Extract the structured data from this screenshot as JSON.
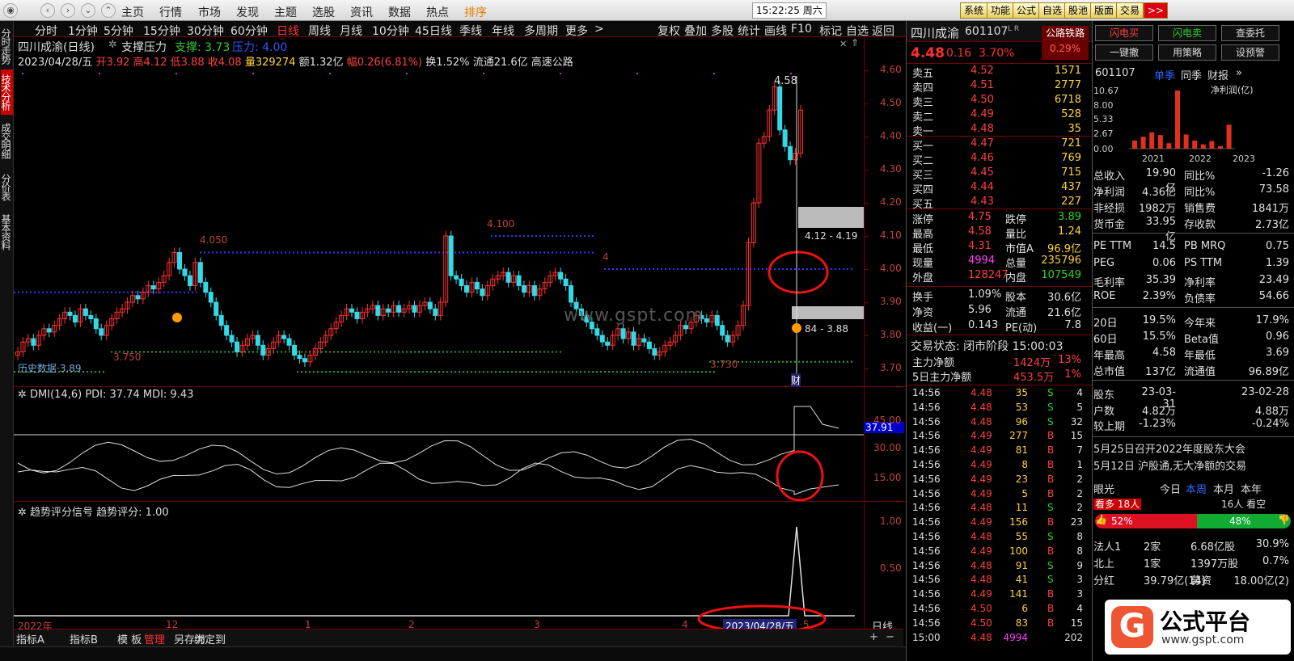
{
  "topmenu": {
    "items": [
      "主页",
      "行情",
      "市场",
      "发现",
      "主题",
      "选股",
      "资讯",
      "数据",
      "热点",
      "排序"
    ],
    "clock": "15:22:25 周六",
    "right_buttons": [
      "系统",
      "功能",
      "公式",
      "自选",
      "股池",
      "版面",
      "交易",
      ">>"
    ]
  },
  "left_tabs": [
    "分时走势",
    "技术分析",
    "成交明细",
    "分价表",
    "基本资料"
  ],
  "periods": {
    "items": [
      "分时",
      "1分钟",
      "5分钟",
      "15分钟",
      "30分钟",
      "60分钟",
      "日线",
      "周线",
      "月线",
      "10分钟",
      "45日线",
      "季线",
      "年线",
      "多周期",
      "更多"
    ],
    "active": "日线",
    "more_arrow": ">"
  },
  "tools": [
    "复权",
    "叠加",
    "多股",
    "统计",
    "画线",
    "F10",
    "标记",
    "自选",
    "返回"
  ],
  "chart": {
    "title": "四川成渝(日线)",
    "indicator": "支撑压力",
    "support_label": "支撑: 3.73",
    "pressure_label": "压力: 4.00",
    "info": {
      "date": "2023/04/28/五",
      "open": "开3.92",
      "high": "高4.12",
      "low": "低3.88",
      "close": "收4.08",
      "vol": "量329274",
      "amt": "额1.32亿",
      "chg": "幅0.26(6.81%)",
      "turn": "换1.52%",
      "float": "流通21.6亿",
      "sector": "高速公路"
    },
    "annotations": {
      "peak1": "4.050",
      "peak2": "4.100",
      "peak3": "4",
      "peak4": "4.58",
      "low1": "3.750",
      "low2": "3.730",
      "low3": "3.89",
      "range1": "4.12 - 4.19",
      "range2": "84 - 3.88",
      "cai": "财",
      "watermark": "www.gspt.com",
      "faded_text": "历史数据"
    },
    "yticks": [
      "4.60",
      "4.50",
      "4.40",
      "4.30",
      "4.20",
      "4.10",
      "4.00",
      "3.90",
      "3.80",
      "3.70"
    ],
    "dmi": {
      "label": "DMI(14,6) PDI: 37.74 MDI: 9.43",
      "yticks": [
        "45.00",
        "30.00",
        "15.00"
      ],
      "current": "37.91"
    },
    "trend": {
      "label": "趋势评分信号 趋势评分: 1.00",
      "yticks": [
        "1.00",
        "0.50"
      ]
    },
    "xaxis": [
      "2022年",
      "12",
      "1",
      "2",
      "3",
      "4",
      "5"
    ],
    "cursor_date": "2023/04/28/五",
    "period_label": "日线"
  },
  "bottom_tabs": [
    "指标A",
    "指标B",
    "模 板",
    "管理",
    "另存为",
    "绑定到"
  ],
  "quote": {
    "name": "四川成渝",
    "code": "601107",
    "flags": "L R",
    "price": "4.48",
    "chg": "0.16",
    "pct": "3.70%",
    "sector": "公路铁路",
    "sector_pct": "0.29%",
    "sells": [
      [
        "卖五",
        "4.52",
        "1571"
      ],
      [
        "卖四",
        "4.51",
        "2777"
      ],
      [
        "卖三",
        "4.50",
        "6718"
      ],
      [
        "卖二",
        "4.49",
        "528"
      ],
      [
        "卖一",
        "4.48",
        "35"
      ]
    ],
    "buys": [
      [
        "买一",
        "4.47",
        "721"
      ],
      [
        "买二",
        "4.46",
        "769"
      ],
      [
        "买三",
        "4.45",
        "715"
      ],
      [
        "买四",
        "4.44",
        "437"
      ],
      [
        "买五",
        "4.43",
        "227"
      ]
    ],
    "stats": [
      [
        "涨停",
        "4.75",
        "跌停",
        "3.89"
      ],
      [
        "最高",
        "4.58",
        "量比",
        "1.24"
      ],
      [
        "最低",
        "4.31",
        "市值A",
        "96.9亿"
      ],
      [
        "现量",
        "4994",
        "总量",
        "235796"
      ],
      [
        "外盘",
        "128247",
        "内盘",
        "107549"
      ]
    ],
    "stats2": [
      [
        "换手",
        "1.09%",
        "股本",
        "30.6亿"
      ],
      [
        "净资",
        "5.96",
        "流通",
        "21.6亿"
      ],
      [
        "收益(一)",
        "0.143",
        "PE(动)",
        "7.8"
      ]
    ],
    "status": "交易状态: 闭市阶段 15:00:03",
    "flow": [
      [
        "主力净额",
        "1424万",
        "13%"
      ],
      [
        "5日主力净额",
        "453.5万",
        "1%"
      ]
    ]
  },
  "ticks": [
    [
      "14:56",
      "4.48",
      "35",
      "S",
      "4"
    ],
    [
      "14:56",
      "4.48",
      "53",
      "S",
      "5"
    ],
    [
      "14:56",
      "4.48",
      "96",
      "S",
      "32"
    ],
    [
      "14:56",
      "4.49",
      "277",
      "B",
      "15"
    ],
    [
      "14:56",
      "4.49",
      "81",
      "B",
      "7"
    ],
    [
      "14:56",
      "4.49",
      "8",
      "B",
      "1"
    ],
    [
      "14:56",
      "4.49",
      "23",
      "B",
      "2"
    ],
    [
      "14:56",
      "4.49",
      "5",
      "B",
      "2"
    ],
    [
      "14:56",
      "4.48",
      "11",
      "S",
      "2"
    ],
    [
      "14:56",
      "4.49",
      "156",
      "B",
      "23"
    ],
    [
      "14:56",
      "4.48",
      "55",
      "S",
      "8"
    ],
    [
      "14:56",
      "4.49",
      "100",
      "B",
      "8"
    ],
    [
      "14:56",
      "4.48",
      "91",
      "S",
      "9"
    ],
    [
      "14:56",
      "4.48",
      "41",
      "S",
      "3"
    ],
    [
      "14:56",
      "4.49",
      "141",
      "B",
      "3"
    ],
    [
      "14:56",
      "4.50",
      "6",
      "B",
      "4"
    ],
    [
      "14:56",
      "4.50",
      "83",
      "B",
      "15"
    ],
    [
      "15:00",
      "4.48",
      "4994",
      "",
      "202"
    ]
  ],
  "trade_buttons": [
    "闪电买",
    "闪电卖",
    "查委托",
    "一键撤",
    "用策略",
    "设预警"
  ],
  "fin": {
    "code": "601107",
    "tabs": [
      "单季",
      "同季",
      "财报"
    ],
    "chart_label": "净利润(亿)",
    "y": [
      "10.67",
      "8.00",
      "5.33",
      "2.67",
      "0.00"
    ],
    "years": [
      "2021",
      "2022",
      "2023"
    ],
    "bars": [
      1.5,
      2.2,
      3.0,
      2.5,
      1.0,
      10.67,
      2.6,
      1.5,
      0.8,
      1.4,
      0.5,
      4.4
    ],
    "rows": [
      [
        "总收入",
        "19.90亿",
        "同比%",
        "-1.26"
      ],
      [
        "净利润",
        "4.36亿",
        "同比%",
        "73.58"
      ],
      [
        "非经损",
        "1982万",
        "销售费",
        "1841万"
      ],
      [
        "货币金",
        "33.95亿",
        "存收款",
        "2.73亿"
      ],
      [
        "PE TTM",
        "14.5",
        "PB MRQ",
        "0.75"
      ],
      [
        "PEG",
        "0.06",
        "PS TTM",
        "1.39"
      ],
      [
        "毛利率",
        "35.39",
        "净利率",
        "23.49"
      ],
      [
        "ROE",
        "2.39%",
        "负债率",
        "54.66"
      ],
      [
        "20日",
        "19.5%",
        "今年来",
        "17.9%"
      ],
      [
        "60日",
        "15.5%",
        "Beta值",
        "0.96"
      ],
      [
        "年最高",
        "4.58",
        "年最低",
        "3.69"
      ],
      [
        "总市值",
        "137亿",
        "流通值",
        "96.89亿"
      ],
      [
        "股东",
        "23-03-31",
        "",
        "23-02-28"
      ],
      [
        "户数",
        "4.82万",
        "",
        "4.88万"
      ],
      [
        "较上期",
        "-1.23%",
        "",
        "-0.24%"
      ]
    ],
    "news": [
      "5月25日召开2022年度股东大会",
      "5月12日 沪股通,无大净额的交易"
    ],
    "sentiment": {
      "label": "眼光",
      "tabs": [
        "今日",
        "本周",
        "本月",
        "本年"
      ],
      "bull": "看多 18人",
      "bear": "16人 看空",
      "bull_pct": "52%",
      "bear_pct": "48%"
    },
    "inst": [
      [
        "法人1",
        "2家",
        "6.68亿股",
        "30.9%"
      ],
      [
        "北上",
        "1家",
        "1397万股",
        "0.7%"
      ],
      [
        "分红",
        "39.79亿(14)",
        "募资",
        "18.00亿(2)"
      ]
    ]
  },
  "logo": {
    "text": "公式平台",
    "url": "www.gspt.com"
  },
  "colors": {
    "up": "#ff3030",
    "down": "#33d9e6",
    "bg": "#000000",
    "border": "#7a0000"
  }
}
